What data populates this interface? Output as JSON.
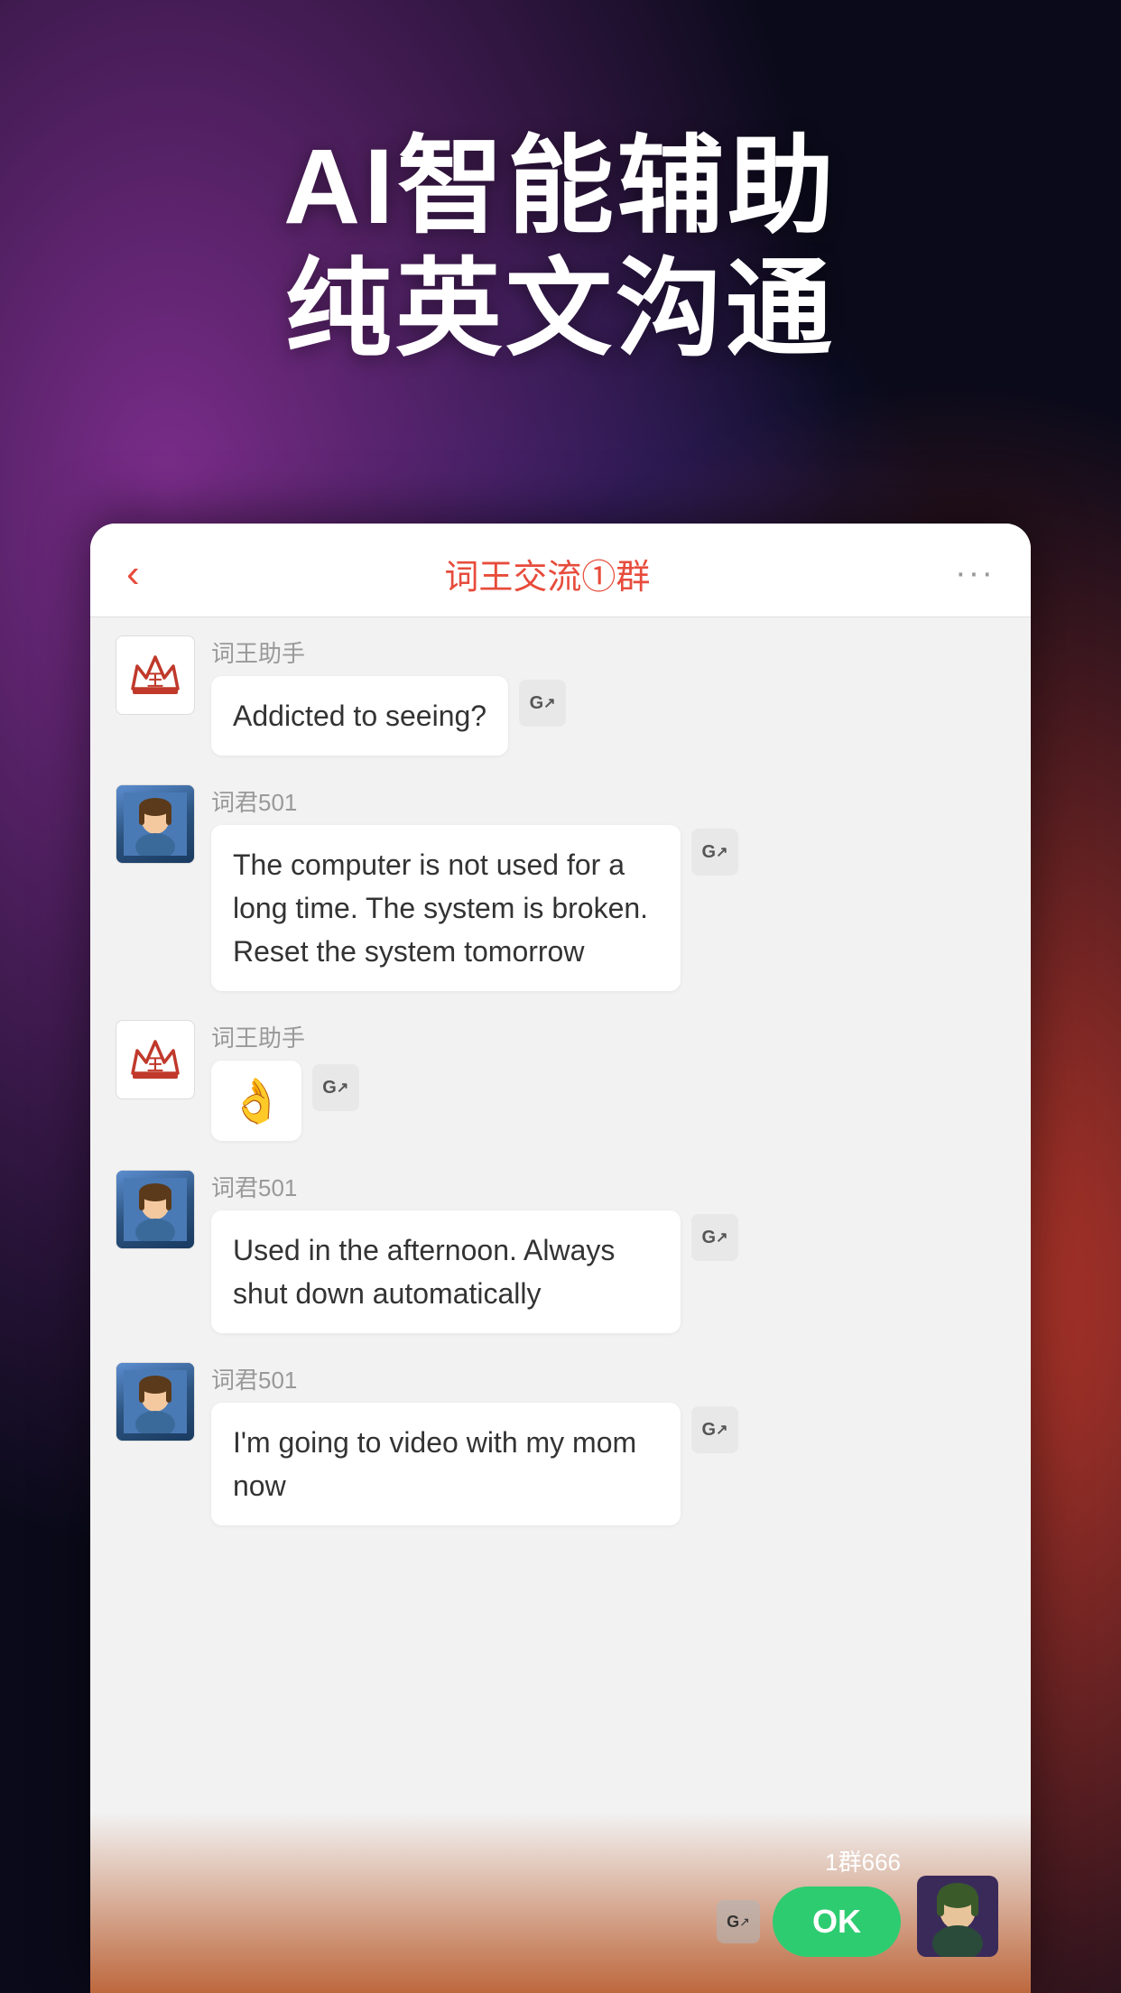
{
  "background": {
    "colors": [
      "#1a1a5e",
      "#6a3fa0",
      "#c0392b"
    ]
  },
  "hero": {
    "line1": "AI智能辅助",
    "line2": "纯英文沟通"
  },
  "chat": {
    "back_label": "‹",
    "title": "词王交流①群",
    "more_label": "···",
    "messages": [
      {
        "sender": "词王助手",
        "sender_type": "assistant",
        "content": "Addicted to seeing?",
        "has_translate": true,
        "is_emoji": false
      },
      {
        "sender": "词君501",
        "sender_type": "user",
        "content": "The computer is not used for a long time. The system is broken. Reset the system tomorrow",
        "has_translate": true,
        "is_emoji": false
      },
      {
        "sender": "词王助手",
        "sender_type": "assistant",
        "content": "👌",
        "has_translate": true,
        "is_emoji": true
      },
      {
        "sender": "词君501",
        "sender_type": "user",
        "content": "Used in the afternoon. Always shut down automatically",
        "has_translate": true,
        "is_emoji": false
      },
      {
        "sender": "词君501",
        "sender_type": "user",
        "content": "I'm going to video with my mom now",
        "has_translate": true,
        "is_emoji": false
      }
    ]
  },
  "bottom_bar": {
    "group_label": "1群666",
    "ok_label": "OK",
    "translate_icon_label": "G↗"
  }
}
